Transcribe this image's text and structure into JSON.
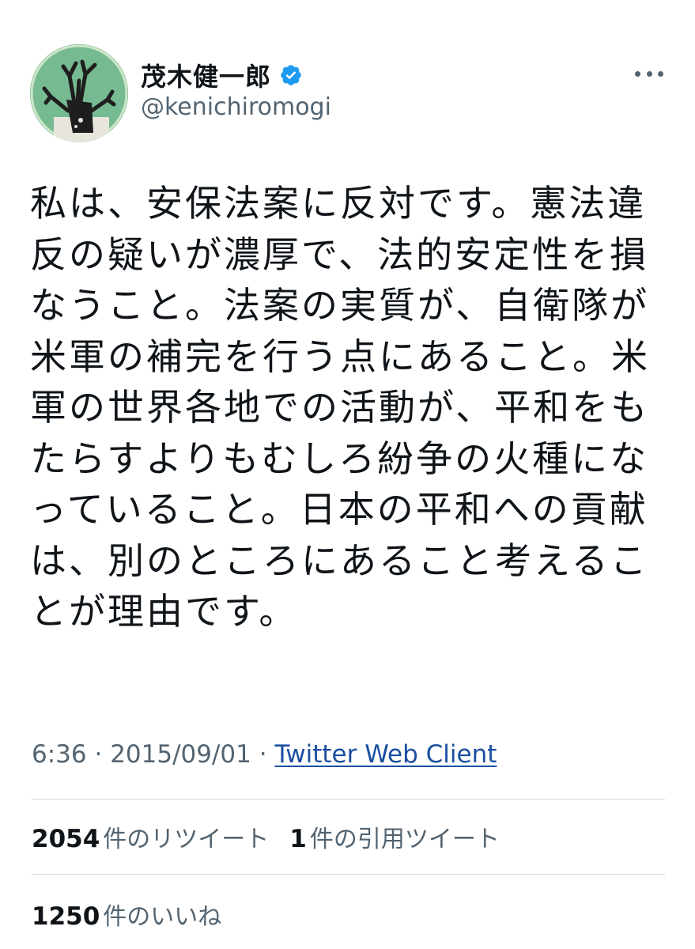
{
  "user": {
    "display_name": "茂木健一郎",
    "handle": "@kenichiromogi",
    "verified_icon": "verified-badge-icon",
    "accent_color": "#1d9bf0"
  },
  "header": {
    "more_icon": "more-dots-icon"
  },
  "tweet": {
    "text": "私は、安保法案に反対です。憲法違反の疑いが濃厚で、法的安定性を損なうこと。法案の実質が、自衛隊が米軍の補完を行う点にあること。米軍の世界各地での活動が、平和をもたらすよりもむしろ紛争の火種になっていること。日本の平和への貢献は、別のところにあること考えることが理由です。"
  },
  "meta": {
    "time": "6:36",
    "separator": "·",
    "date": "2015/09/01",
    "source": "Twitter Web Client"
  },
  "stats": {
    "retweets_count": "2054",
    "retweets_label": "件のリツイート",
    "quotes_count": "1",
    "quotes_label": "件の引用ツイート",
    "likes_count": "1250",
    "likes_label": "件のいいね"
  }
}
